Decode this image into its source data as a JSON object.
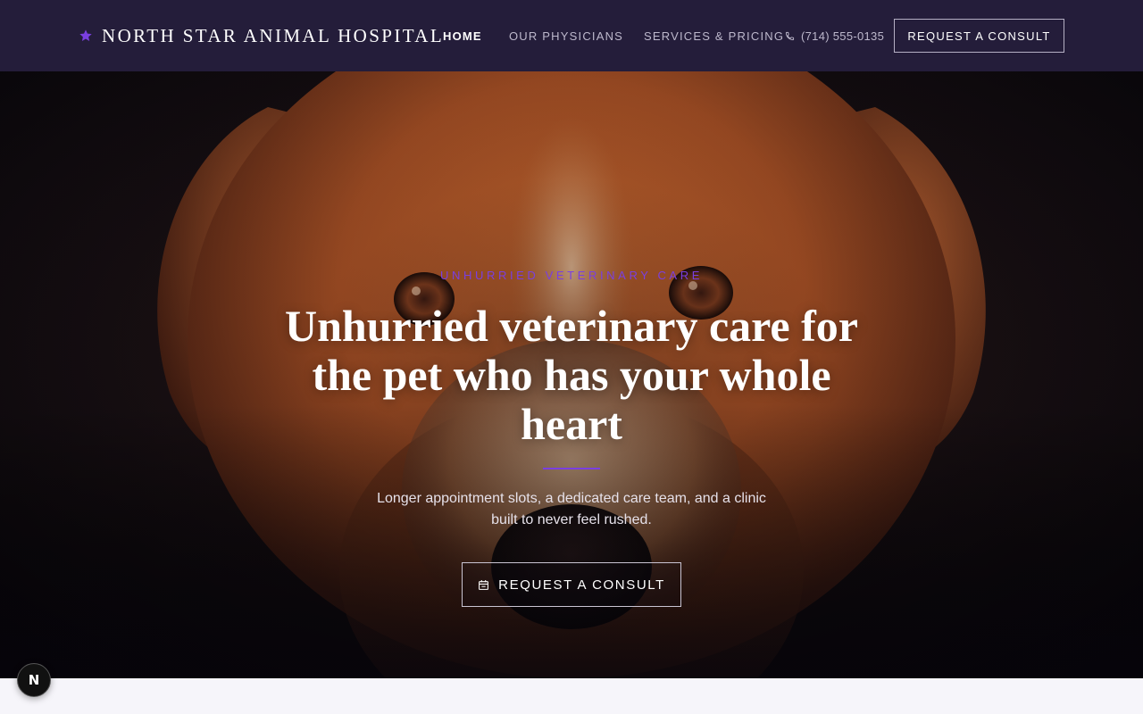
{
  "header": {
    "brand_name": "NORTH STAR ANIMAL HOSPITAL",
    "brand_icon": "star-icon",
    "nav": [
      {
        "label": "HOME",
        "active": true
      },
      {
        "label": "OUR PHYSICIANS",
        "active": false
      },
      {
        "label": "SERVICES & PRICING",
        "active": false
      }
    ],
    "phone": "(714) 555-0135",
    "phone_icon": "phone-icon",
    "cta_label": "REQUEST A CONSULT"
  },
  "hero": {
    "eyebrow": "UNHURRIED VETERINARY CARE",
    "title": "Unhurried veterinary care for the pet who has your whole heart",
    "subtitle": "Longer appointment slots, a dedicated care team, and a clinic built to never feel rushed.",
    "cta_label": "REQUEST A CONSULT",
    "cta_icon": "calendar-icon"
  },
  "dev_badge": {
    "label": "N",
    "icon": "nextjs-logo-icon"
  },
  "colors": {
    "header_bg": "#241d3a",
    "accent": "#7a3fe0",
    "page_bg": "#f6f5fa"
  }
}
